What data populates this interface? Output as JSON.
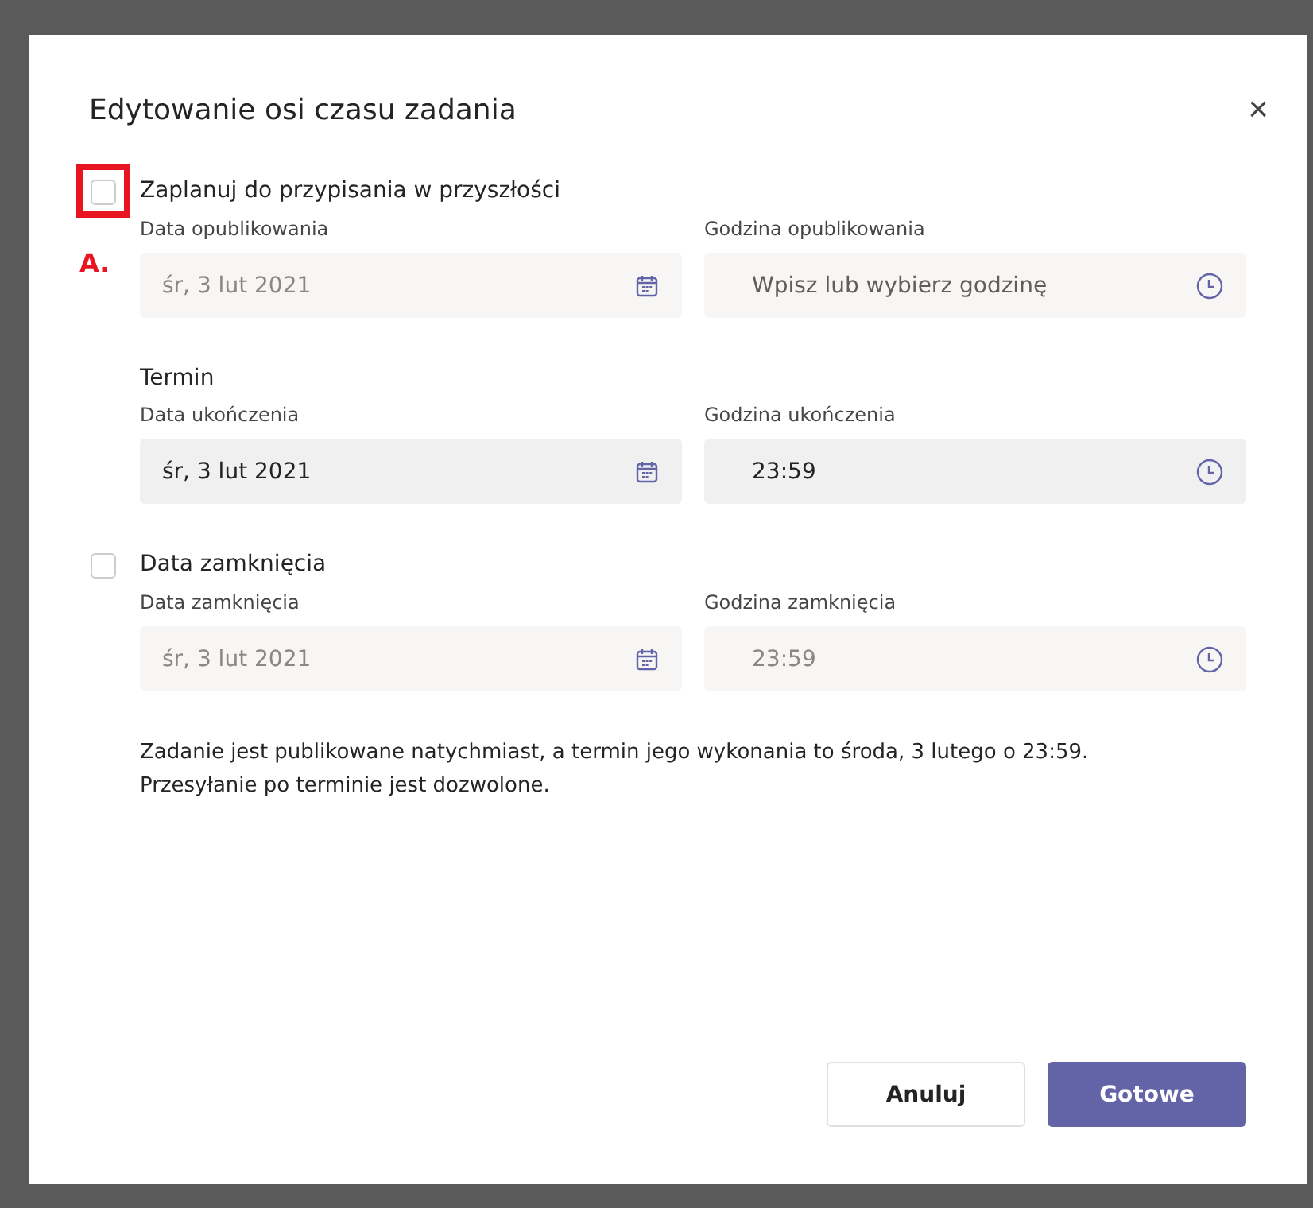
{
  "dialog": {
    "title": "Edytowanie osi czasu zadania",
    "close": "×"
  },
  "annotation": {
    "label": "A."
  },
  "sections": [
    {
      "kind": "checkbox",
      "label": "Zaplanuj do przypisania w przyszłości",
      "checked": false,
      "annotated": true,
      "fields": [
        {
          "kind": "date",
          "label": "Data opublikowania",
          "value": "śr, 3 lut 2021",
          "disabled": true
        },
        {
          "kind": "time",
          "label": "Godzina opublikowania",
          "placeholder": "Wpisz lub wybierz godzinę",
          "disabled": true
        }
      ]
    },
    {
      "kind": "heading",
      "label": "Termin",
      "fields": [
        {
          "kind": "date",
          "label": "Data ukończenia",
          "value": "śr, 3 lut 2021",
          "disabled": false
        },
        {
          "kind": "time",
          "label": "Godzina ukończenia",
          "value": "23:59",
          "disabled": false
        }
      ]
    },
    {
      "kind": "checkbox",
      "label": "Data zamknięcia",
      "checked": false,
      "fields": [
        {
          "kind": "date",
          "label": "Data zamknięcia",
          "value": "śr, 3 lut 2021",
          "disabled": true
        },
        {
          "kind": "time",
          "label": "Godzina zamknięcia",
          "value": "23:59",
          "disabled": true
        }
      ]
    }
  ],
  "summary": [
    "Zadanie jest publikowane natychmiast, a termin jego wykonania to środa, 3 lutego o 23:59.",
    "Przesyłanie po terminie jest dozwolone."
  ],
  "buttons": [
    {
      "label": "Anuluj",
      "kind": "secondary"
    },
    {
      "label": "Gotowe",
      "kind": "primary"
    }
  ]
}
